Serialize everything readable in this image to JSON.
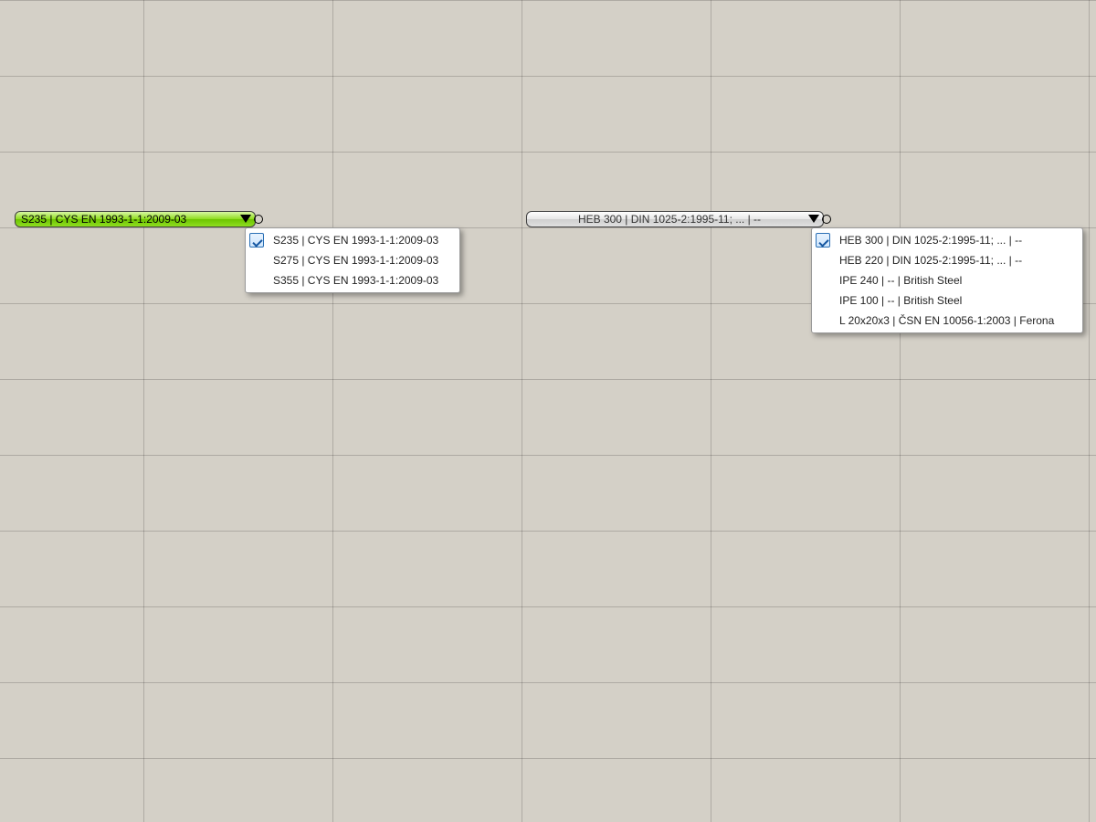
{
  "material_dropdown": {
    "selected_label": "S235 | CYS EN 1993-1-1:2009-03",
    "options": [
      {
        "label": "S235 | CYS EN 1993-1-1:2009-03",
        "selected": true
      },
      {
        "label": "S275 | CYS EN 1993-1-1:2009-03",
        "selected": false
      },
      {
        "label": "S355 | CYS EN 1993-1-1:2009-03",
        "selected": false
      }
    ]
  },
  "section_dropdown": {
    "selected_label": "HEB 300 | DIN 1025-2:1995-11; ... | --",
    "options": [
      {
        "label": "HEB 300 | DIN 1025-2:1995-11; ... | --",
        "selected": true
      },
      {
        "label": "HEB 220 | DIN 1025-2:1995-11; ... | --",
        "selected": false
      },
      {
        "label": "IPE 240 | -- | British Steel",
        "selected": false
      },
      {
        "label": "IPE 100 | -- | British Steel",
        "selected": false
      },
      {
        "label": "L 20x20x3 | ČSN EN 10056-1:2003 | Ferona",
        "selected": false
      }
    ]
  }
}
